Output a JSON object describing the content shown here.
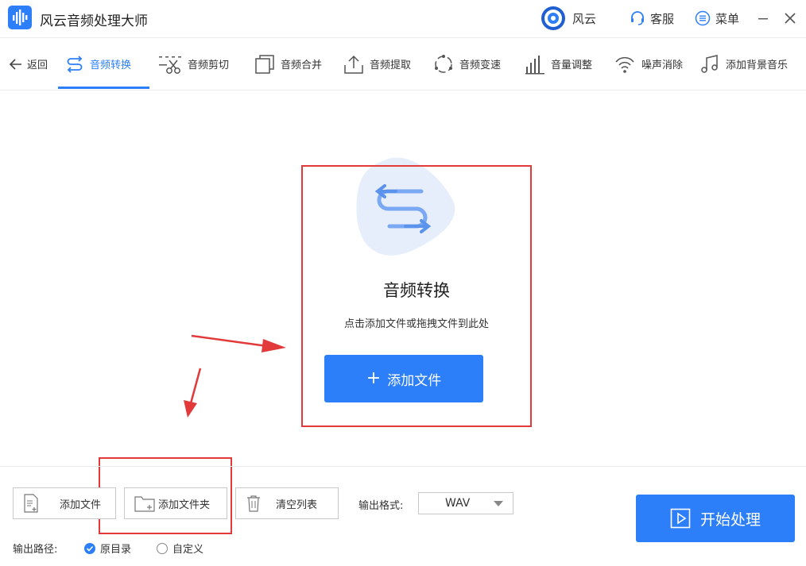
{
  "titlebar": {
    "app_title": "风云音频处理大师",
    "user_name": "风云",
    "service_label": "客服",
    "menu_label": "菜单"
  },
  "toolbar": {
    "back_label": "返回",
    "tools": [
      {
        "label": "音频转换",
        "icon": "convert-icon",
        "active": true
      },
      {
        "label": "音频剪切",
        "icon": "scissors-icon"
      },
      {
        "label": "音频合并",
        "icon": "merge-icon"
      },
      {
        "label": "音频提取",
        "icon": "extract-icon"
      },
      {
        "label": "音频变速",
        "icon": "speed-icon"
      },
      {
        "label": "音量调整",
        "icon": "volume-bars-icon"
      },
      {
        "label": "噪声消除",
        "icon": "noise-icon"
      },
      {
        "label": "添加背景音乐",
        "icon": "music-note-icon"
      }
    ]
  },
  "hero": {
    "title": "音频转换",
    "subtitle": "点击添加文件或拖拽文件到此处",
    "add_button": "添加文件"
  },
  "bottom": {
    "add_file": "添加文件",
    "add_folder": "添加文件夹",
    "clear_list": "清空列表",
    "format_label": "输出格式:",
    "format_value": "WAV",
    "start_label": "开始处理",
    "path_label": "输出路径:",
    "path_options": [
      {
        "label": "原目录",
        "selected": true
      },
      {
        "label": "自定义",
        "selected": false
      }
    ]
  },
  "colors": {
    "accent": "#2d7ff9",
    "annotation": "#e23a3a"
  }
}
